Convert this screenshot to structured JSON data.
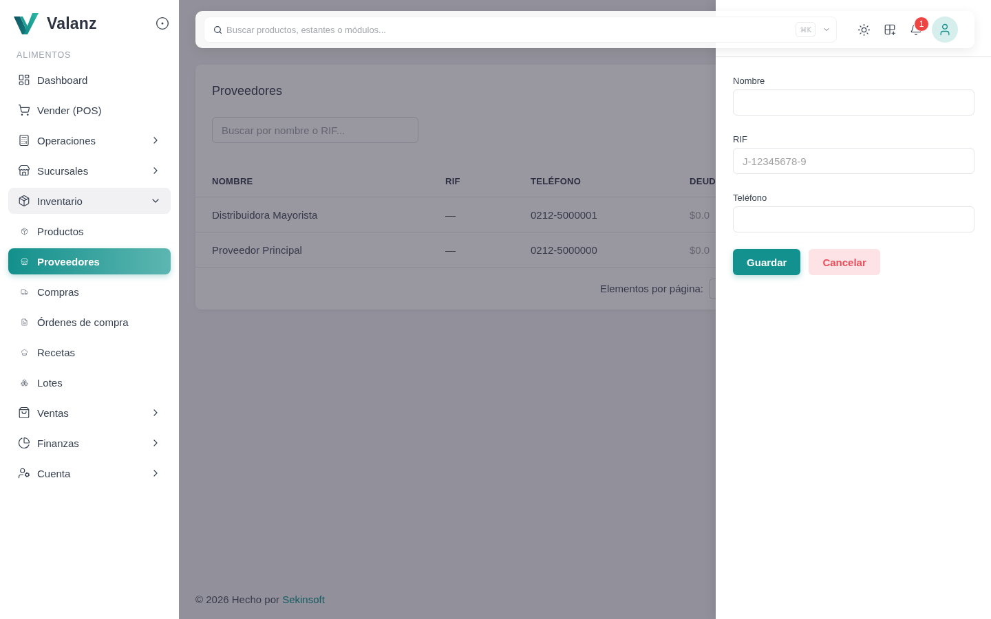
{
  "app": {
    "name": "Valanz"
  },
  "sidebar": {
    "section": "ALIMENTOS",
    "items": [
      {
        "label": "Dashboard",
        "kind": "link",
        "selected": false
      },
      {
        "label": "Vender (POS)",
        "kind": "link",
        "selected": false
      },
      {
        "label": "Operaciones",
        "kind": "group",
        "selected": false,
        "expanded": false
      },
      {
        "label": "Sucursales",
        "kind": "group",
        "selected": false,
        "expanded": false
      },
      {
        "label": "Inventario",
        "kind": "group",
        "selected": false,
        "expanded": true,
        "children": [
          {
            "label": "Productos",
            "selected": false
          },
          {
            "label": "Proveedores",
            "selected": true
          },
          {
            "label": "Compras",
            "selected": false
          },
          {
            "label": "Órdenes de compra",
            "selected": false
          },
          {
            "label": "Recetas",
            "selected": false
          },
          {
            "label": "Lotes",
            "selected": false
          }
        ]
      },
      {
        "label": "Ventas",
        "kind": "group",
        "selected": false,
        "expanded": false
      },
      {
        "label": "Finanzas",
        "kind": "group",
        "selected": false,
        "expanded": false
      },
      {
        "label": "Cuenta",
        "kind": "group",
        "selected": false,
        "expanded": false
      }
    ]
  },
  "header": {
    "search": {
      "placeholder": "Buscar productos, estantes o módulos..."
    },
    "shortcut": "⌘K",
    "notifications": "1"
  },
  "page": {
    "title": "Proveedores",
    "search": {
      "placeholder": "Buscar por nombre o RIF..."
    },
    "table": {
      "columns": [
        "NOMBRE",
        "RIF",
        "TELÉFONO",
        "DEUD"
      ],
      "rows": [
        [
          "Distribuidora Mayorista",
          "—",
          "0212-5000001",
          "$0.0"
        ],
        [
          "Proveedor Principal",
          "—",
          "0212-5000000",
          "$0.0"
        ]
      ]
    },
    "pagination": {
      "label": "Elementos por página:"
    }
  },
  "footer": {
    "text": "© 2026 Hecho por",
    "link": "Sekinsoft"
  },
  "drawer": {
    "fields": [
      {
        "label": "Nombre"
      },
      {
        "label": "RIF",
        "placeholder": "J-12345678-9"
      },
      {
        "label": "Teléfono"
      }
    ],
    "buttons": [
      {
        "label": "Guardar",
        "kind": "primary"
      },
      {
        "label": "Cancelar",
        "kind": "danger"
      }
    ]
  }
}
